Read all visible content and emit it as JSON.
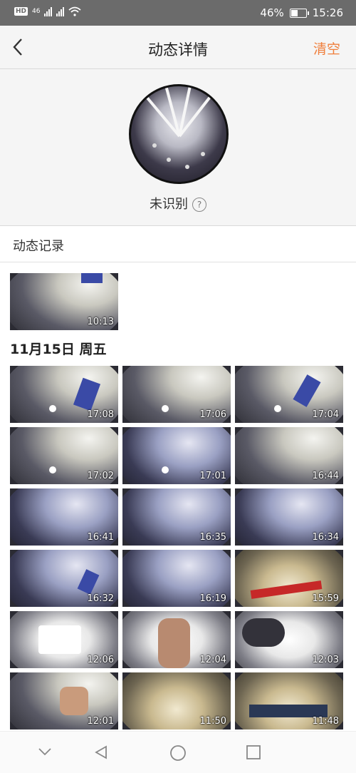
{
  "status_bar": {
    "left_badge": "HD",
    "network": "46",
    "battery": "46%",
    "battery_level": 0.46,
    "time": "15:26"
  },
  "header": {
    "title": "动态详情",
    "clear_label": "清空"
  },
  "profile": {
    "status_label": "未识别",
    "help_glyph": "?"
  },
  "records": {
    "label": "动态记录"
  },
  "first_group": {
    "thumbs": [
      {
        "time": "10:13"
      }
    ]
  },
  "group": {
    "date_label": "11月15日 周五",
    "thumbs": [
      {
        "time": "17:08"
      },
      {
        "time": "17:06"
      },
      {
        "time": "17:04"
      },
      {
        "time": "17:02"
      },
      {
        "time": "17:01"
      },
      {
        "time": "16:44"
      },
      {
        "time": "16:41"
      },
      {
        "time": "16:35"
      },
      {
        "time": "16:34"
      },
      {
        "time": "16:32"
      },
      {
        "time": "16:19"
      },
      {
        "time": "15:59"
      },
      {
        "time": "12:06"
      },
      {
        "time": "12:04"
      },
      {
        "time": "12:03"
      },
      {
        "time": "12:01"
      },
      {
        "time": "11:50"
      },
      {
        "time": "11:48"
      }
    ]
  },
  "colors": {
    "accent": "#f07f3c",
    "status_bar": "#6b6b6b",
    "header_bg": "#f5f5f5"
  }
}
